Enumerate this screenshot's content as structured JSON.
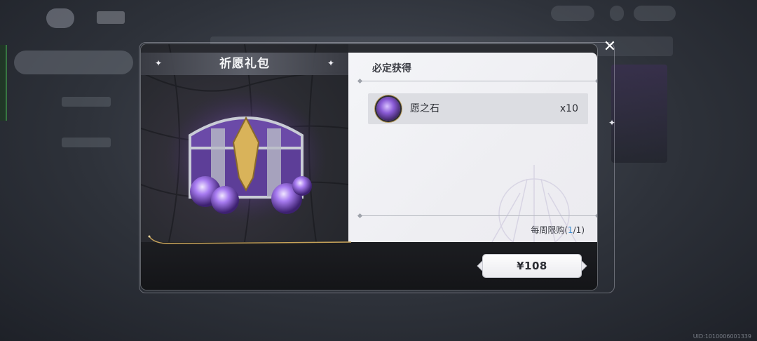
{
  "dialog": {
    "title": "祈愿礼包",
    "section_title": "必定获得",
    "close_icon": "close-icon"
  },
  "reward_items": [
    {
      "name": "愿之石",
      "quantity": "x10",
      "icon": "wish-stone-icon"
    }
  ],
  "purchase_limit": {
    "label": "每周限购(",
    "count": "1",
    "suffix": "/1)"
  },
  "price_button": {
    "label": "¥108"
  },
  "footer": {
    "uid": "UID:1010006001339"
  },
  "colors": {
    "accent_gold": "#c9a45a",
    "limit_blue": "#3f8fd0",
    "chest_purple": "#7b4fc7"
  }
}
